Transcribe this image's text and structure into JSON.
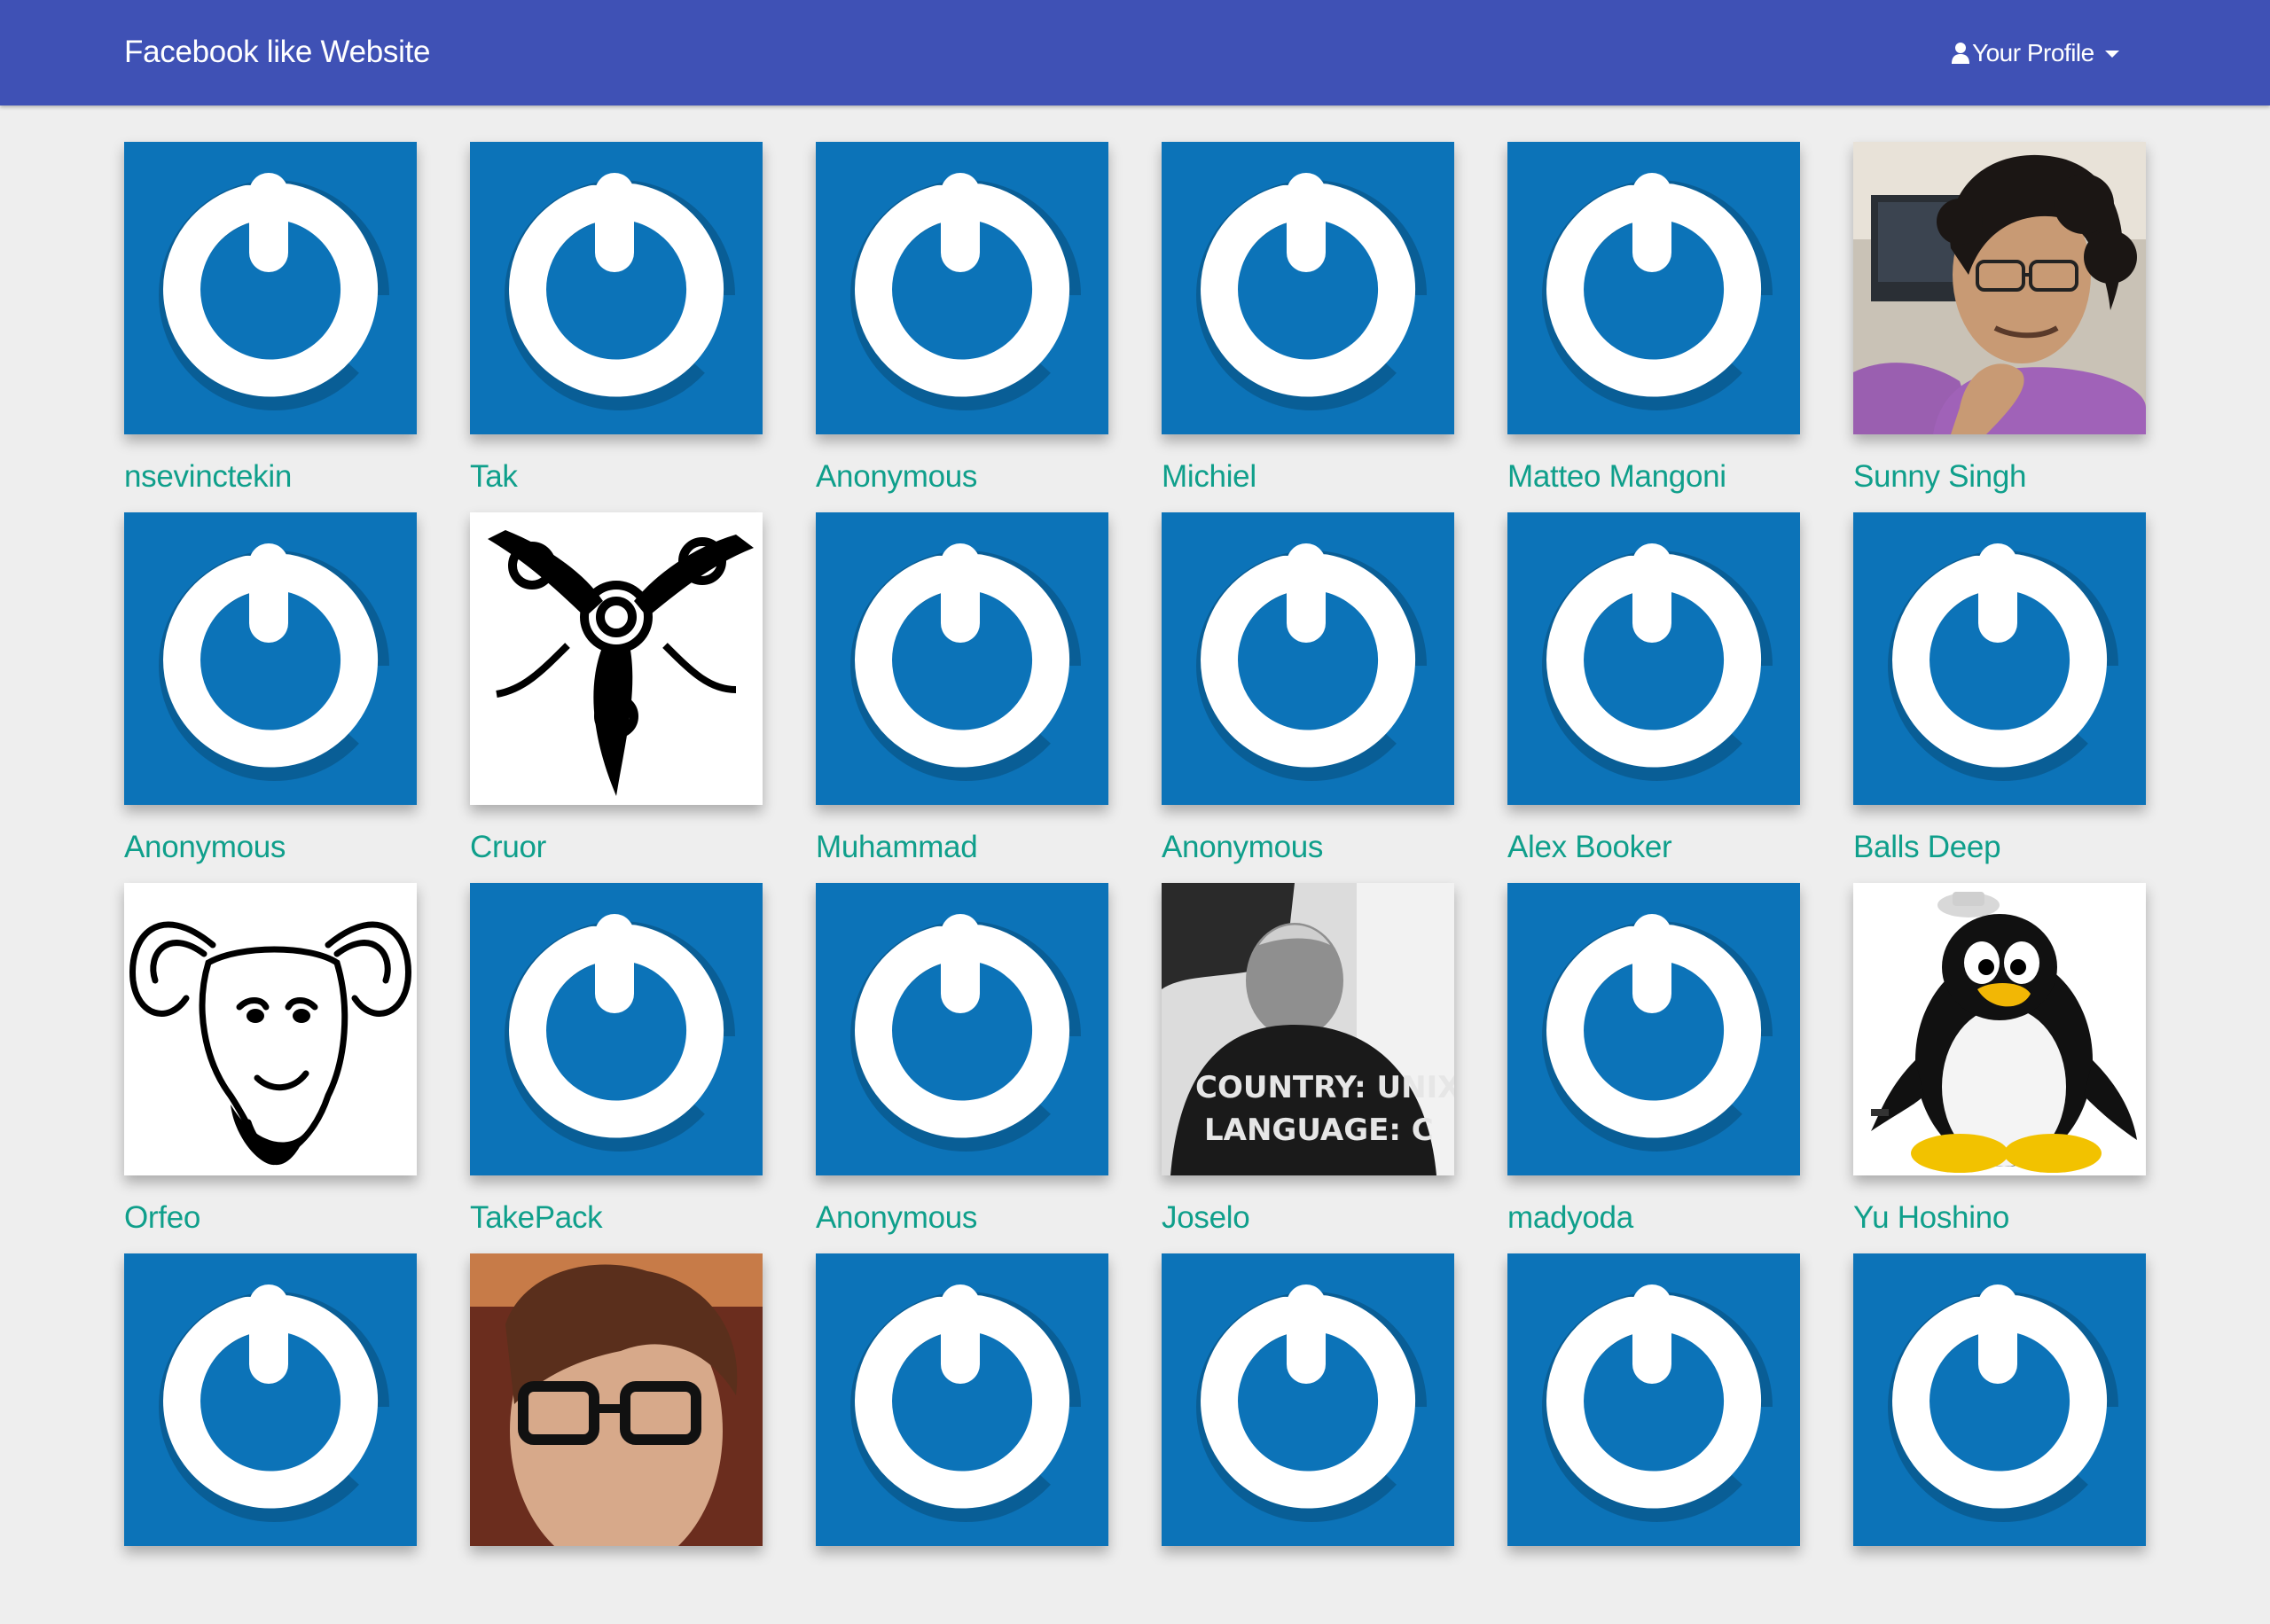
{
  "navbar": {
    "brand": "Facebook like Website",
    "profile_label": "Your Profile",
    "color": "#3f51b5"
  },
  "colors": {
    "background": "#eeeeee",
    "name_link": "#0f9f8b",
    "default_avatar": "#0c73b8"
  },
  "users": [
    {
      "name": "nsevinctekin",
      "avatar": "default"
    },
    {
      "name": "Tak",
      "avatar": "default"
    },
    {
      "name": "Anonymous",
      "avatar": "default"
    },
    {
      "name": "Michiel",
      "avatar": "default"
    },
    {
      "name": "Matteo Mangoni",
      "avatar": "default"
    },
    {
      "name": "Sunny Singh",
      "avatar": "photo-man-glasses"
    },
    {
      "name": "Anonymous",
      "avatar": "default"
    },
    {
      "name": "Cruor",
      "avatar": "triskele-tattoo"
    },
    {
      "name": "Muhammad",
      "avatar": "default"
    },
    {
      "name": "Anonymous",
      "avatar": "default"
    },
    {
      "name": "Alex Booker",
      "avatar": "default"
    },
    {
      "name": "Balls Deep",
      "avatar": "default"
    },
    {
      "name": "Orfeo",
      "avatar": "gnu-head"
    },
    {
      "name": "TakePack",
      "avatar": "default"
    },
    {
      "name": "Anonymous",
      "avatar": "default"
    },
    {
      "name": "Joselo",
      "avatar": "photo-unix-shirt",
      "avatar_text": [
        "COUNTRY: UNIX",
        "LANGUAGE: C"
      ]
    },
    {
      "name": "madyoda",
      "avatar": "default"
    },
    {
      "name": "Yu Hoshino",
      "avatar": "tux-penguin"
    },
    {
      "name": "",
      "avatar": "default"
    },
    {
      "name": "",
      "avatar": "photo-person-glasses"
    },
    {
      "name": "",
      "avatar": "default"
    },
    {
      "name": "",
      "avatar": "default"
    },
    {
      "name": "",
      "avatar": "default"
    },
    {
      "name": "",
      "avatar": "default"
    }
  ]
}
